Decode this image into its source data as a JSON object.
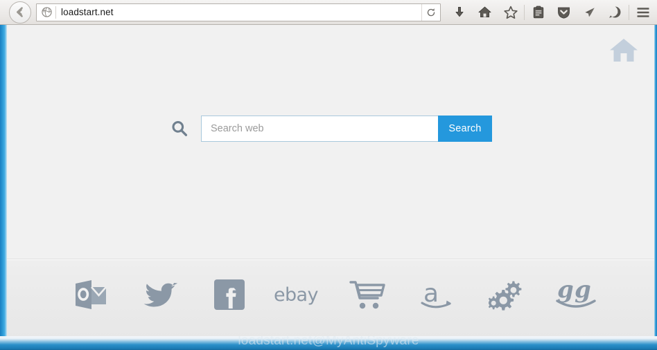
{
  "browser": {
    "back_button": "back-arrow-icon",
    "favicon": "globe-icon",
    "url": "loadstart.net",
    "reload_label": "reload-icon",
    "toolbar_icons": [
      {
        "name": "downloads-icon",
        "label": "Downloads"
      },
      {
        "name": "home-icon",
        "label": "Home"
      },
      {
        "name": "bookmark-star-icon",
        "label": "Bookmarks"
      },
      {
        "name": "reader-clipboard-icon",
        "label": "Reader View"
      },
      {
        "name": "pocket-shield-icon",
        "label": "Pocket"
      },
      {
        "name": "paper-plane-icon",
        "label": "Send"
      },
      {
        "name": "smiley-face-icon",
        "label": "Feedback"
      },
      {
        "name": "hamburger-menu-icon",
        "label": "Open Menu"
      }
    ]
  },
  "page": {
    "home_icon": "home-icon",
    "search": {
      "placeholder": "Search web",
      "value": "",
      "button_label": "Search",
      "glass_icon": "magnifier-icon"
    },
    "shortcuts": [
      {
        "name": "outlook",
        "label": "Outlook"
      },
      {
        "name": "twitter",
        "label": "Twitter"
      },
      {
        "name": "facebook",
        "label": "Facebook"
      },
      {
        "name": "ebay",
        "label": "ebay"
      },
      {
        "name": "shopping-cart",
        "label": "Shopping"
      },
      {
        "name": "amazon",
        "label": "Amazon"
      },
      {
        "name": "gears-settings",
        "label": "Settings"
      },
      {
        "name": "gg-smile",
        "label": "gg"
      }
    ],
    "watermark": "loadstart.net@MyAntiSpyware"
  },
  "colors": {
    "accent_blue": "#2498dd",
    "frame_blue": "#1a7fc1",
    "page_bg": "#f1f1f1",
    "footer_bg": "#e9e9e9",
    "icon_gray": "#7b8b99",
    "home_icon_blue": "#c3cfdc"
  }
}
